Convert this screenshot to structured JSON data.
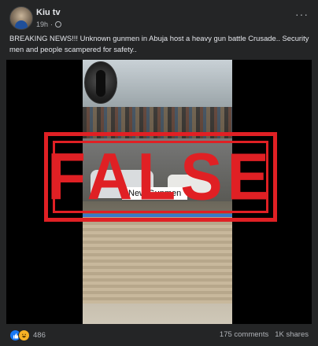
{
  "post": {
    "author": "Kiu tv",
    "time": "19h",
    "time_separator": "·",
    "privacy_icon": "globe-icon",
    "more_label": "···",
    "text": "BREAKING NEWS!!! Unknown gunmen in Abuja host a heavy gun battle Crusade.. Security men and people scampered for safety..",
    "media": {
      "caption": "New Gunmen",
      "stamp": "FALSE",
      "stamp_color": "#e02024"
    },
    "reactions": {
      "icons": [
        "like-icon",
        "haha-icon"
      ],
      "count": "486"
    },
    "comments": "175 comments",
    "shares": "1K shares"
  },
  "colors": {
    "background": "#242526",
    "text": "#e4e6eb",
    "secondary_text": "#b0b3b8",
    "like_blue": "#1877f2"
  }
}
